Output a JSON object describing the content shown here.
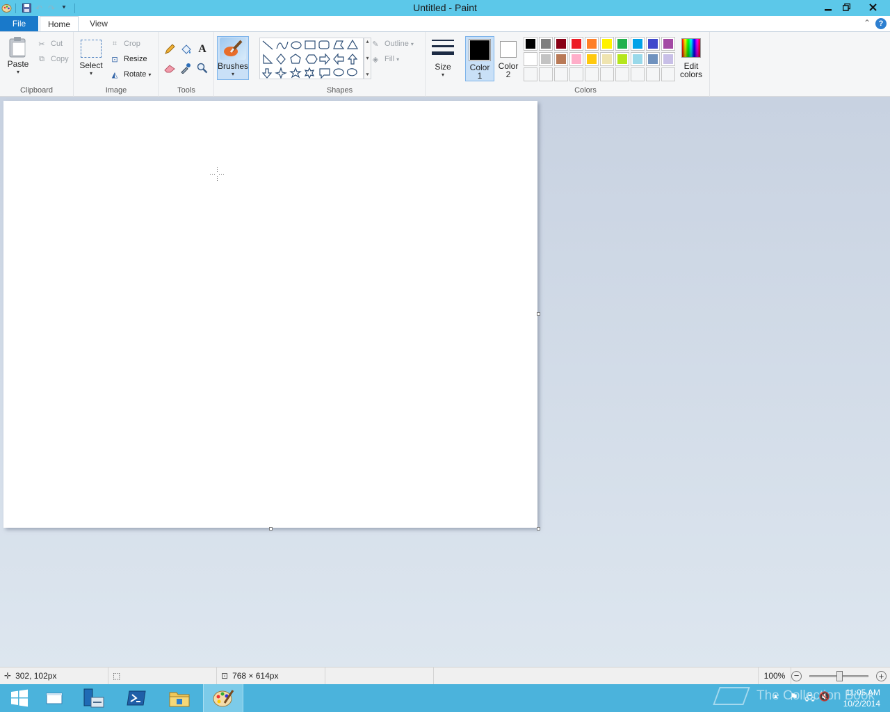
{
  "window": {
    "title": "Untitled - Paint",
    "minimize_icon": "minimize-icon",
    "restore_icon": "restore-icon",
    "close_icon": "close-icon"
  },
  "quick_access": {
    "icons": [
      "paint-app-icon",
      "save-icon",
      "undo-icon",
      "redo-icon",
      "customize-dropdown-icon"
    ]
  },
  "tabs": {
    "file": "File",
    "home": "Home",
    "view": "View"
  },
  "ribbon": {
    "clipboard": {
      "label": "Clipboard",
      "paste": "Paste",
      "cut": "Cut",
      "copy": "Copy"
    },
    "image": {
      "label": "Image",
      "select": "Select",
      "crop": "Crop",
      "resize": "Resize",
      "rotate": "Rotate"
    },
    "tools": {
      "label": "Tools",
      "items": [
        "pencil-icon",
        "fill-bucket-icon",
        "text-icon",
        "eraser-icon",
        "color-picker-icon",
        "magnifier-icon"
      ]
    },
    "brushes": {
      "label": "Brushes"
    },
    "shapes": {
      "label": "Shapes",
      "outline": "Outline",
      "fill": "Fill"
    },
    "size": {
      "label": "Size"
    },
    "colors": {
      "label": "Colors",
      "color1_line1": "Color",
      "color1_line2": "1",
      "color2_line1": "Color",
      "color2_line2": "2",
      "edit_line1": "Edit",
      "edit_line2": "colors",
      "color1_value": "#000000",
      "color2_value": "#ffffff",
      "palette_row1": [
        "#000000",
        "#7f7f7f",
        "#880015",
        "#ed1c24",
        "#ff7f27",
        "#fff200",
        "#22b14c",
        "#00a2e8",
        "#3f48cc",
        "#a349a4"
      ],
      "palette_row2": [
        "#ffffff",
        "#c3c3c3",
        "#b97a57",
        "#ffaec9",
        "#ffc90e",
        "#efe4b0",
        "#b5e61d",
        "#99d9ea",
        "#7092be",
        "#c8bfe7"
      ]
    }
  },
  "status": {
    "cursor_pos": "302, 102px",
    "canvas_size": "768 × 614px",
    "zoom": "100%",
    "zoom_fraction": 0.5
  },
  "taskbar": {
    "time": "11:05 AM",
    "date": "10/2/2014",
    "watermark": "The Collection Book"
  }
}
